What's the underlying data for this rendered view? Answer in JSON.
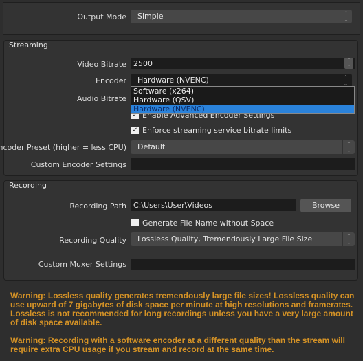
{
  "output_mode": {
    "label": "Output Mode",
    "value": "Simple"
  },
  "streaming": {
    "title": "Streaming",
    "video_bitrate": {
      "label": "Video Bitrate",
      "value": "2500"
    },
    "encoder": {
      "label": "Encoder",
      "value": "Hardware (NVENC)",
      "options": [
        "Software (x264)",
        "Hardware (QSV)",
        "Hardware (NVENC)"
      ]
    },
    "audio_bitrate": {
      "label": "Audio Bitrate"
    },
    "advanced": {
      "label": "Enable Advanced Encoder Settings",
      "checked": true
    },
    "enforce": {
      "label": "Enforce streaming service bitrate limits",
      "checked": true
    },
    "preset": {
      "label": "Encoder Preset (higher = less CPU)",
      "value": "Default"
    },
    "custom": {
      "label": "Custom Encoder Settings",
      "value": ""
    }
  },
  "recording": {
    "title": "Recording",
    "path": {
      "label": "Recording Path",
      "value": "C:\\Users\\User\\Videos",
      "browse": "Browse"
    },
    "nospace": {
      "label": "Generate File Name without Space",
      "checked": false
    },
    "quality": {
      "label": "Recording Quality",
      "value": "Lossless Quality, Tremendously Large File Size"
    },
    "muxer": {
      "label": "Custom Muxer Settings",
      "value": ""
    }
  },
  "warnings": [
    "Warning: Lossless quality generates tremendously large file sizes!  Lossless quality can use upward of 7 gigabytes of disk space per minute at high resolutions and framerates. Lossless is not recommended for long recordings unless you have a very large amount of disk space available.",
    "Warning: Recording with a software encoder at a different quality than the stream will require extra CPU usage if you stream and record at the same time."
  ],
  "colors": {
    "warning": "#d49226",
    "selection": "#2a82da"
  }
}
